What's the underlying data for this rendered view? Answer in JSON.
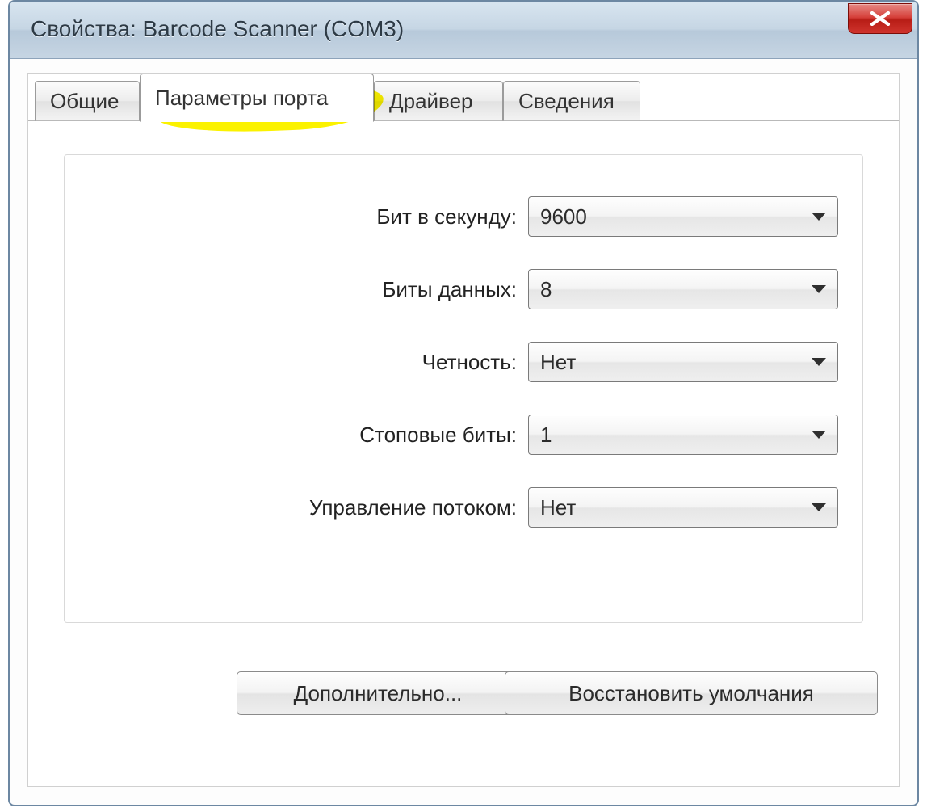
{
  "window": {
    "title": "Свойства: Barcode Scanner (COM3)"
  },
  "tabs": {
    "general": "Общие",
    "port": "Параметры порта",
    "driver": "Драйвер",
    "details": "Сведения"
  },
  "fields": {
    "baud": {
      "label": "Бит в секунду:",
      "value": "9600"
    },
    "data": {
      "label": "Биты данных:",
      "value": "8"
    },
    "parity": {
      "label": "Четность:",
      "value": "Нет"
    },
    "stop": {
      "label": "Стоповые биты:",
      "value": "1"
    },
    "flow": {
      "label": "Управление потоком:",
      "value": "Нет"
    }
  },
  "buttons": {
    "advanced": "Дополнительно...",
    "restore": "Восстановить умолчания"
  }
}
